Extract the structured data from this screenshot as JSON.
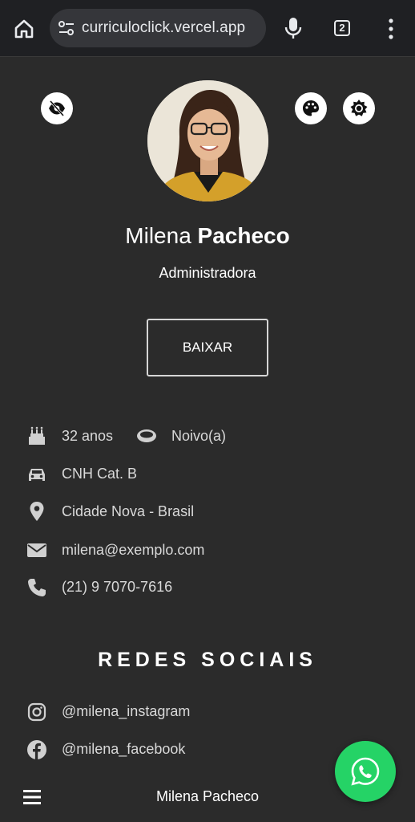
{
  "browser": {
    "url": "curriculoclick.vercel.app",
    "tab_count": "2",
    "icons": [
      "home-icon",
      "site-settings-icon",
      "microphone-icon",
      "tabs-icon",
      "more-vert-icon"
    ]
  },
  "profile": {
    "first_name": "Milena",
    "last_name": "Pacheco",
    "role": "Administradora",
    "download_label": "BAIXAR"
  },
  "top_actions": {
    "icons": [
      "eye-off-icon",
      "palette-icon",
      "brightness-icon"
    ]
  },
  "info": {
    "age": "32 anos",
    "marital_status": "Noivo(a)",
    "license": "CNH Cat. B",
    "location": "Cidade Nova - Brasil",
    "email": "milena@exemplo.com",
    "phone": "(21) 9 7070-7616"
  },
  "social": {
    "title": "REDES SOCIAIS",
    "instagram": "@milena_instagram",
    "facebook": "@milena_facebook"
  },
  "bottom_bar": {
    "name": "Milena Pacheco"
  },
  "colors": {
    "background": "#2b2b2b",
    "text": "#ffffff",
    "muted_text": "#d9d9d9",
    "whatsapp": "#25d366"
  }
}
